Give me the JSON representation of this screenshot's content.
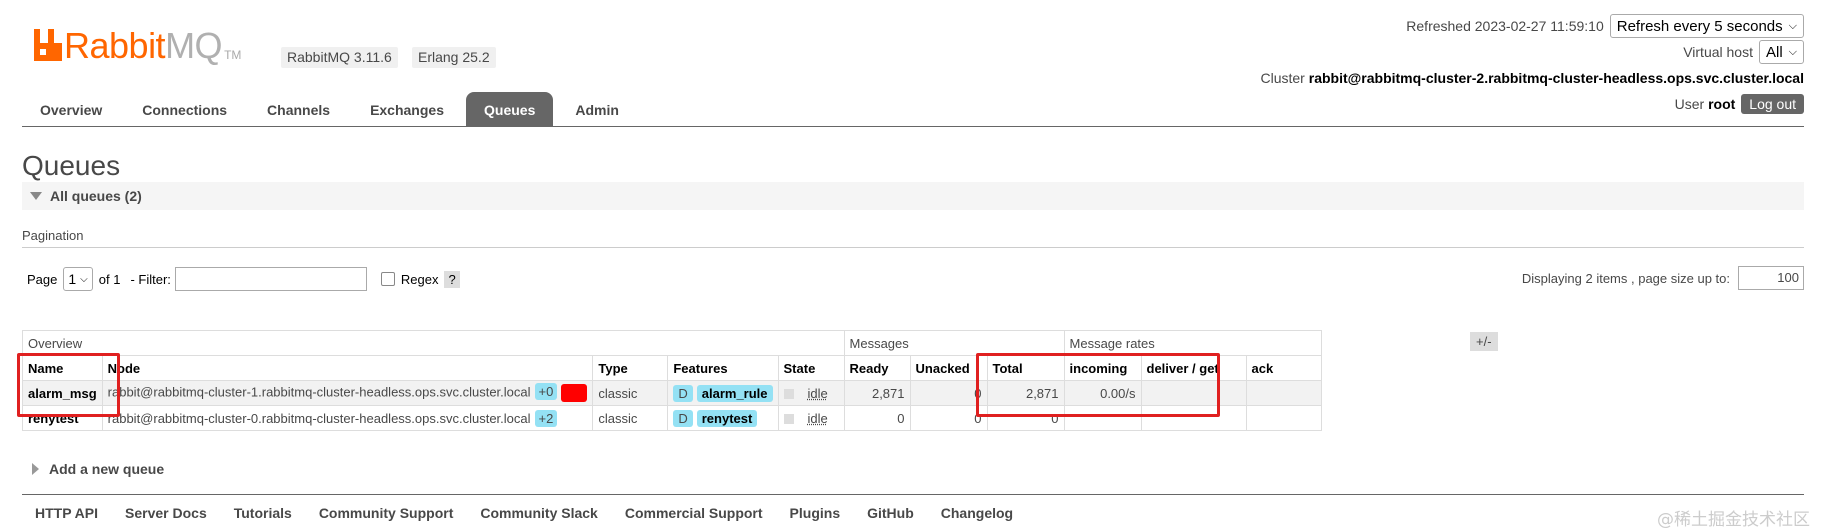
{
  "brand": {
    "name_part1": "Rabbit",
    "name_part2": "MQ",
    "tm": "TM",
    "color": "#ff6600"
  },
  "versions": {
    "rabbitmq": "RabbitMQ 3.11.6",
    "erlang": "Erlang 25.2"
  },
  "header": {
    "refreshed_label": "Refreshed 2023-02-27 11:59:10",
    "refresh_select": "Refresh every 5 seconds",
    "vhost_label": "Virtual host",
    "vhost_select": "All",
    "cluster_label": "Cluster",
    "cluster_name": "rabbit@rabbitmq-cluster-2.rabbitmq-cluster-headless.ops.svc.cluster.local",
    "user_label": "User",
    "user_name": "root",
    "logout": "Log out"
  },
  "tabs": [
    "Overview",
    "Connections",
    "Channels",
    "Exchanges",
    "Queues",
    "Admin"
  ],
  "active_tab": "Queues",
  "page": {
    "title": "Queues",
    "section": "All queues (2)",
    "pagination_label": "Pagination",
    "page_label": "Page",
    "page_value": "1",
    "of_label": "of 1",
    "filter_label": "- Filter:",
    "filter_value": "",
    "regex_label": "Regex",
    "help": "?",
    "display_info": "Displaying 2 items , page size up to:",
    "page_size": "100"
  },
  "table": {
    "groups": {
      "overview": "Overview",
      "messages": "Messages",
      "rates": "Message rates"
    },
    "columns": {
      "name": "Name",
      "node": "Node",
      "type": "Type",
      "features": "Features",
      "state": "State",
      "ready": "Ready",
      "unacked": "Unacked",
      "total": "Total",
      "incoming": "incoming",
      "deliver": "deliver / get",
      "ack": "ack"
    },
    "toggle": "+/-",
    "rows": [
      {
        "name": "alarm_msg",
        "node": "rabbit@rabbitmq-cluster-1.rabbitmq-cluster-headless.ops.svc.cluster.local",
        "replicas": "+0",
        "type": "classic",
        "feature": "D",
        "arg": "alarm_rule",
        "state": "idle",
        "ready": "2,871",
        "unacked": "0",
        "total": "2,871",
        "incoming": "0.00/s",
        "deliver": "",
        "ack": ""
      },
      {
        "name": "renytest",
        "node": "rabbit@rabbitmq-cluster-0.rabbitmq-cluster-headless.ops.svc.cluster.local",
        "replicas": "+2",
        "type": "classic",
        "feature": "D",
        "arg": "renytest",
        "state": "idle",
        "ready": "0",
        "unacked": "0",
        "total": "0",
        "incoming": "",
        "deliver": "",
        "ack": ""
      }
    ]
  },
  "add_queue": "Add a new queue",
  "footer": [
    "HTTP API",
    "Server Docs",
    "Tutorials",
    "Community Support",
    "Community Slack",
    "Commercial Support",
    "Plugins",
    "GitHub",
    "Changelog"
  ],
  "watermark": "@稀土掘金技术社区",
  "highlight_color": "#e02020"
}
